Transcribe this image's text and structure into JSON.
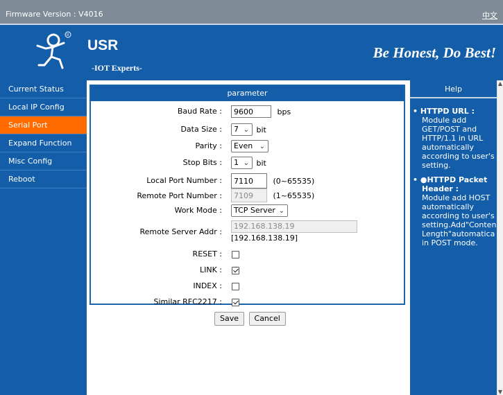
{
  "topbar": {
    "firmware": "Firmware Version : V4016",
    "lang_link": "中文"
  },
  "header": {
    "brand": "USR",
    "tagline": "-IOT Experts-",
    "slogan": "Be Honest, Do Best!"
  },
  "sidebar": {
    "items": [
      {
        "label": "Current Status"
      },
      {
        "label": "Local IP Config"
      },
      {
        "label": "Serial Port"
      },
      {
        "label": "Expand Function"
      },
      {
        "label": "Misc Config"
      },
      {
        "label": "Reboot"
      }
    ],
    "active": "Serial Port"
  },
  "panel": {
    "title": "parameter",
    "baud_rate": {
      "label": "Baud Rate :",
      "value": "9600",
      "unit": "bps"
    },
    "data_size": {
      "label": "Data Size :",
      "value": "7",
      "unit": "bit"
    },
    "parity": {
      "label": "Parity :",
      "value": "Even"
    },
    "stop_bits": {
      "label": "Stop Bits :",
      "value": "1",
      "unit": "bit"
    },
    "local_port": {
      "label": "Local Port Number :",
      "value": "7110",
      "range": "(0~65535)"
    },
    "remote_port": {
      "label": "Remote Port Number :",
      "value": "7109",
      "range": "(1~65535)"
    },
    "work_mode": {
      "label": "Work Mode :",
      "value": "TCP Server"
    },
    "remote_server": {
      "label": "Remote Server Addr :",
      "value": "192.168.138.19",
      "display": "[192.168.138.19]"
    },
    "reset": {
      "label": "RESET :",
      "checked": false
    },
    "link": {
      "label": "LINK :",
      "checked": true
    },
    "index": {
      "label": "INDEX :",
      "checked": false
    },
    "rfc2217": {
      "label": "Similar RFC2217 :",
      "checked": true
    }
  },
  "buttons": {
    "save": "Save",
    "cancel": "Cancel"
  },
  "help": {
    "title": "Help",
    "items": [
      {
        "heading": "• HTTPD URL :",
        "lines": [
          "Module add",
          "GET/POST and",
          "HTTP/1.1 in URL",
          "automatically",
          "according to user's",
          "setting."
        ]
      },
      {
        "heading": "• ●HTTPD Packet",
        "heading2": "Header :",
        "lines": [
          "Module add HOST",
          "automatically",
          "according to user's",
          "setting.Add\"Conten",
          "Length\"automatica",
          "in POST mode."
        ]
      }
    ]
  },
  "colors": {
    "nav_bg": "#135da9",
    "active": "#ff6b00",
    "topbar": "#7e8b96"
  },
  "icons": {
    "logo": "running-person-logo-icon"
  }
}
